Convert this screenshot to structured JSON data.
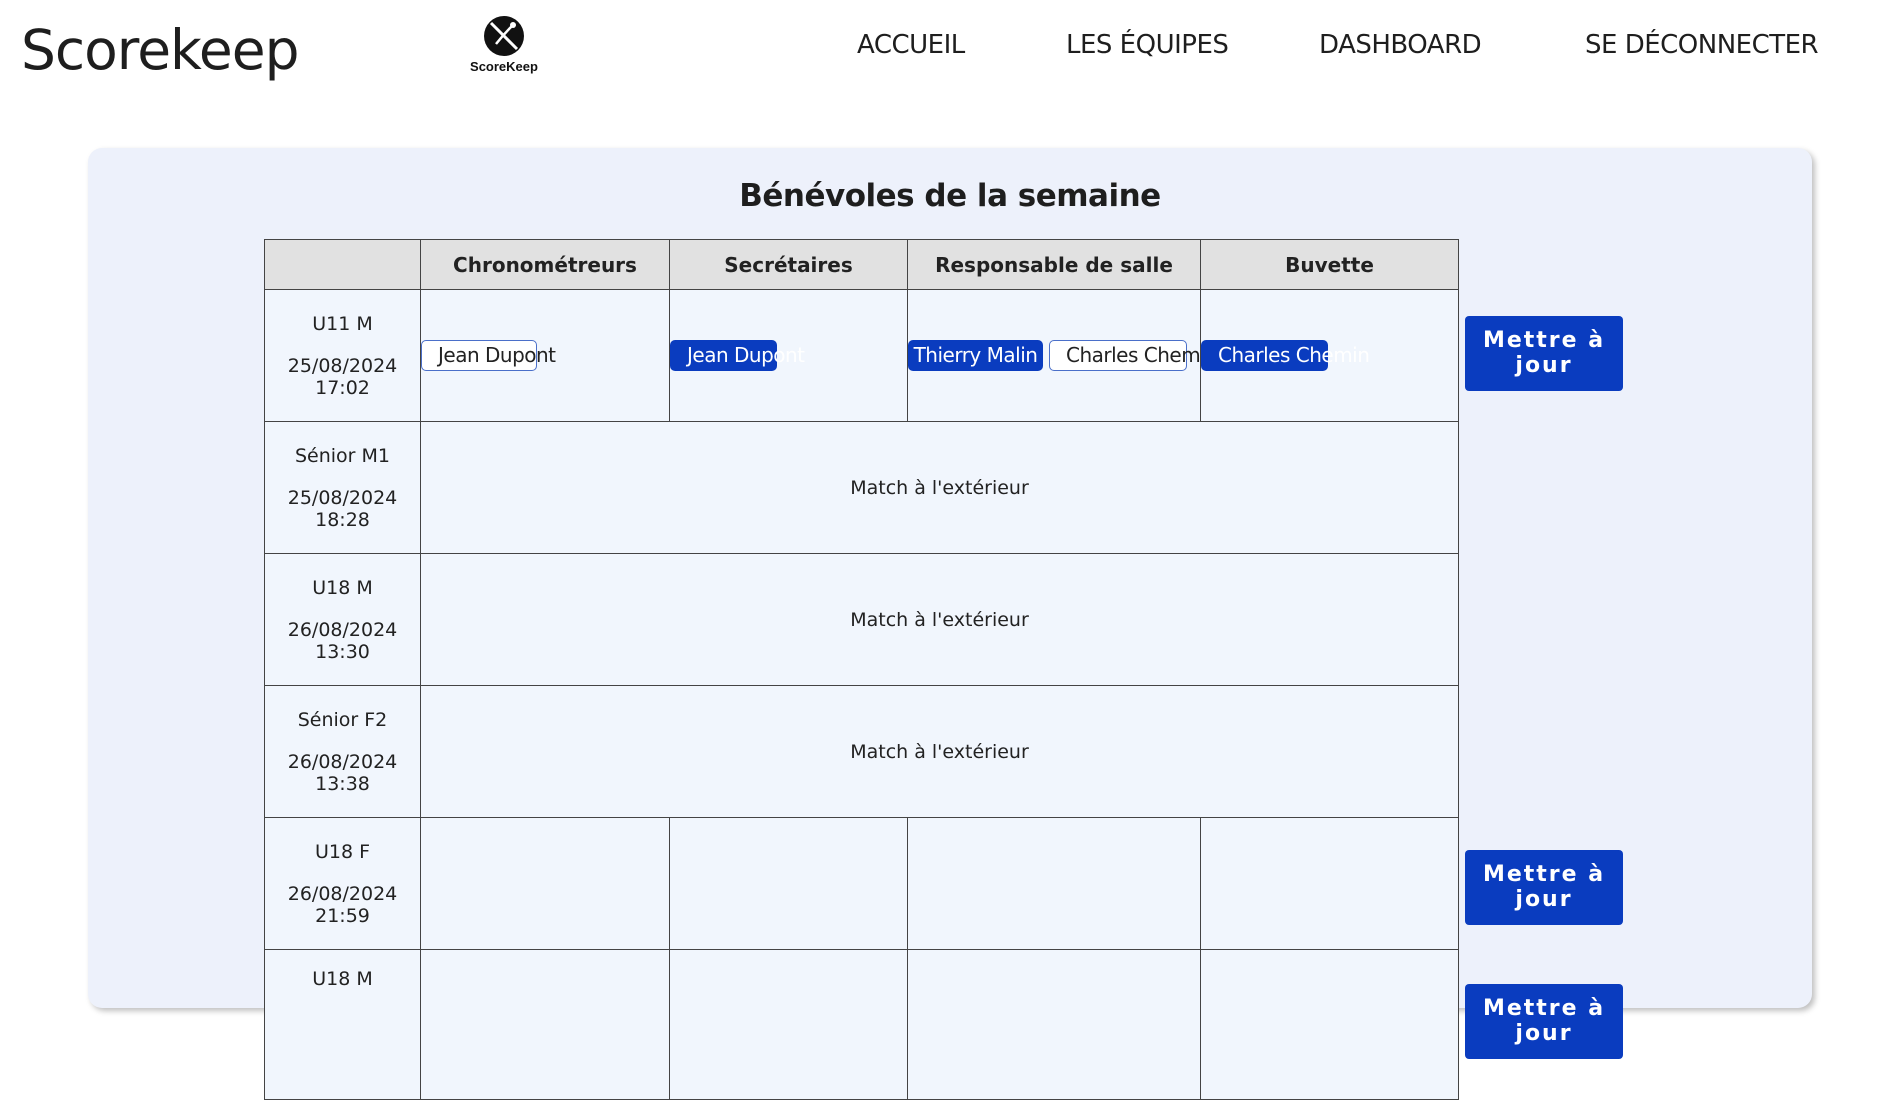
{
  "header": {
    "brand": "Scorekeep",
    "logo_text": "ScoreKeep",
    "nav": [
      "ACCUEIL",
      "LES ÉQUIPES",
      "DASHBOARD",
      "SE DÉCONNECTER"
    ]
  },
  "panel": {
    "title": "Bénévoles de la semaine",
    "columns": [
      "",
      "Chronométreurs",
      "Secrétaires",
      "Responsable de salle",
      "Buvette"
    ],
    "update_label": "Mettre à jour",
    "away_label": "Match à l'extérieur",
    "rows": [
      {
        "team": "U11 M",
        "date": "25/08/2024",
        "time": "17:02",
        "chronometreurs": [
          {
            "name": "Jean Dupont",
            "selected": false
          }
        ],
        "secretaires": [
          {
            "name": "Jean Dupont",
            "selected": true
          }
        ],
        "responsables": [
          {
            "name": "Thierry Malin",
            "selected": true
          },
          {
            "name": "Charles Chemin",
            "selected": false
          }
        ],
        "buvette": [
          {
            "name": "Charles Chemin",
            "selected": true
          }
        ]
      },
      {
        "team": "Sénior M1",
        "date": "25/08/2024",
        "time": "18:28",
        "away": true
      },
      {
        "team": "U18 M",
        "date": "26/08/2024",
        "time": "13:30",
        "away": true
      },
      {
        "team": "Sénior F2",
        "date": "26/08/2024",
        "time": "13:38",
        "away": true
      },
      {
        "team": "U18 F",
        "date": "26/08/2024",
        "time": "21:59"
      },
      {
        "team": "U18 M"
      }
    ]
  },
  "colors": {
    "accent": "#0a3cbf",
    "panel_bg": "#edf1fb",
    "header_cell_bg": "#e1e1e1"
  }
}
